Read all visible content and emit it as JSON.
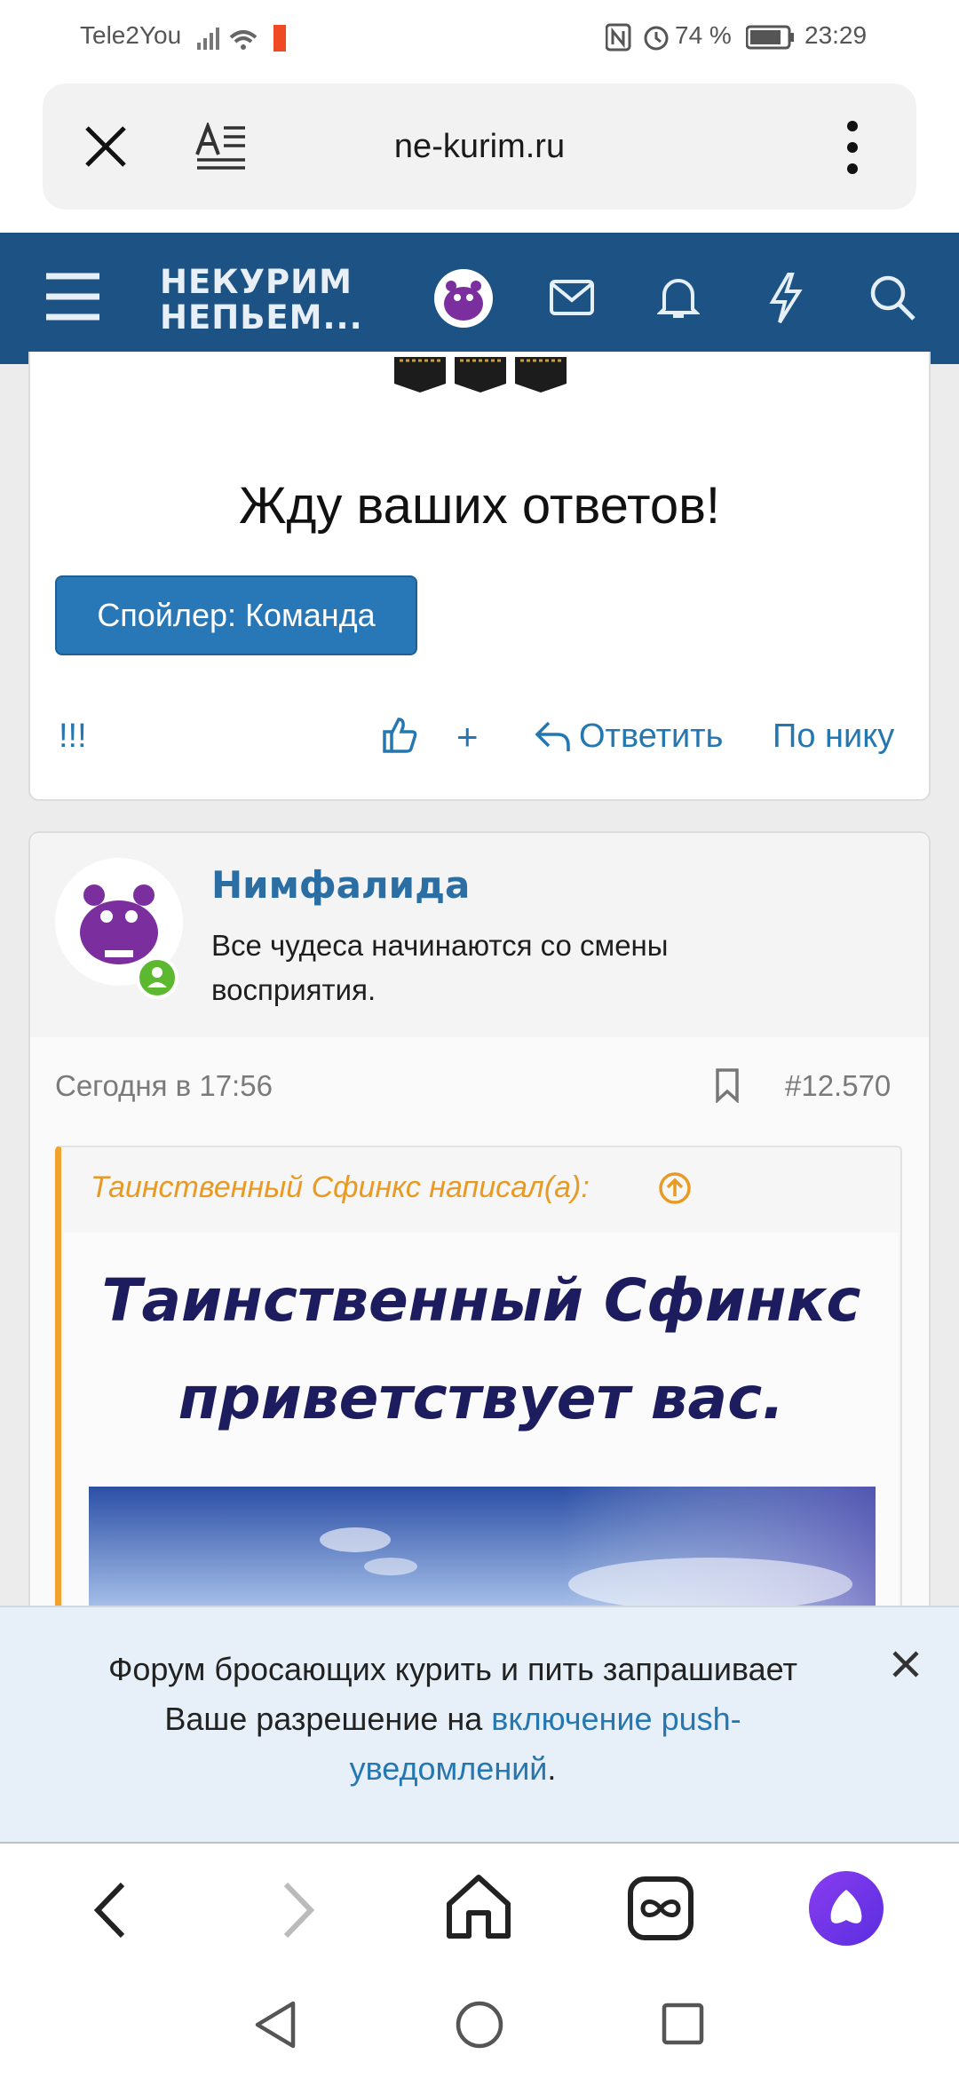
{
  "status_bar": {
    "carrier": "Tele2You",
    "battery": "74 %",
    "time": "23:29"
  },
  "browser": {
    "url": "ne-kurim.ru"
  },
  "site": {
    "logo_line1": "НЕКУРИМ",
    "logo_line2": "НЕПЬЕМ..."
  },
  "post1": {
    "text": "Жду ваших ответов!",
    "spoiler_label": "Спойлер: Команда",
    "marks": "!!!",
    "plus": "+",
    "reply": "Ответить",
    "by_nick": "По нику"
  },
  "post2": {
    "author": "Нимфалида",
    "status": "Все чудеса начинаются со смены восприятия.",
    "status_line1": "Все чудеса начинаются со смены",
    "status_line2": "восприятия.",
    "date": "Сегодня в 17:56",
    "number": "#12.570",
    "quote_header": "Таинственный Сфинкс написал(а):",
    "quote_title_line1": "Таинственный Сфинкс",
    "quote_title_line2": "приветствует вас."
  },
  "push": {
    "line1": "Форум бросающих курить и пить запрашивает",
    "line2_prefix": "Ваше разрешение на ",
    "link_part1": "включение push-",
    "link_part2": "уведомлений",
    "suffix": "."
  },
  "colors": {
    "header": "#1c5384",
    "accent": "#2577b1",
    "quote_border": "#f2a22c",
    "quote_title": "#1c1c5e",
    "avatar": "#7b2f9e",
    "online": "#5cb82e"
  }
}
